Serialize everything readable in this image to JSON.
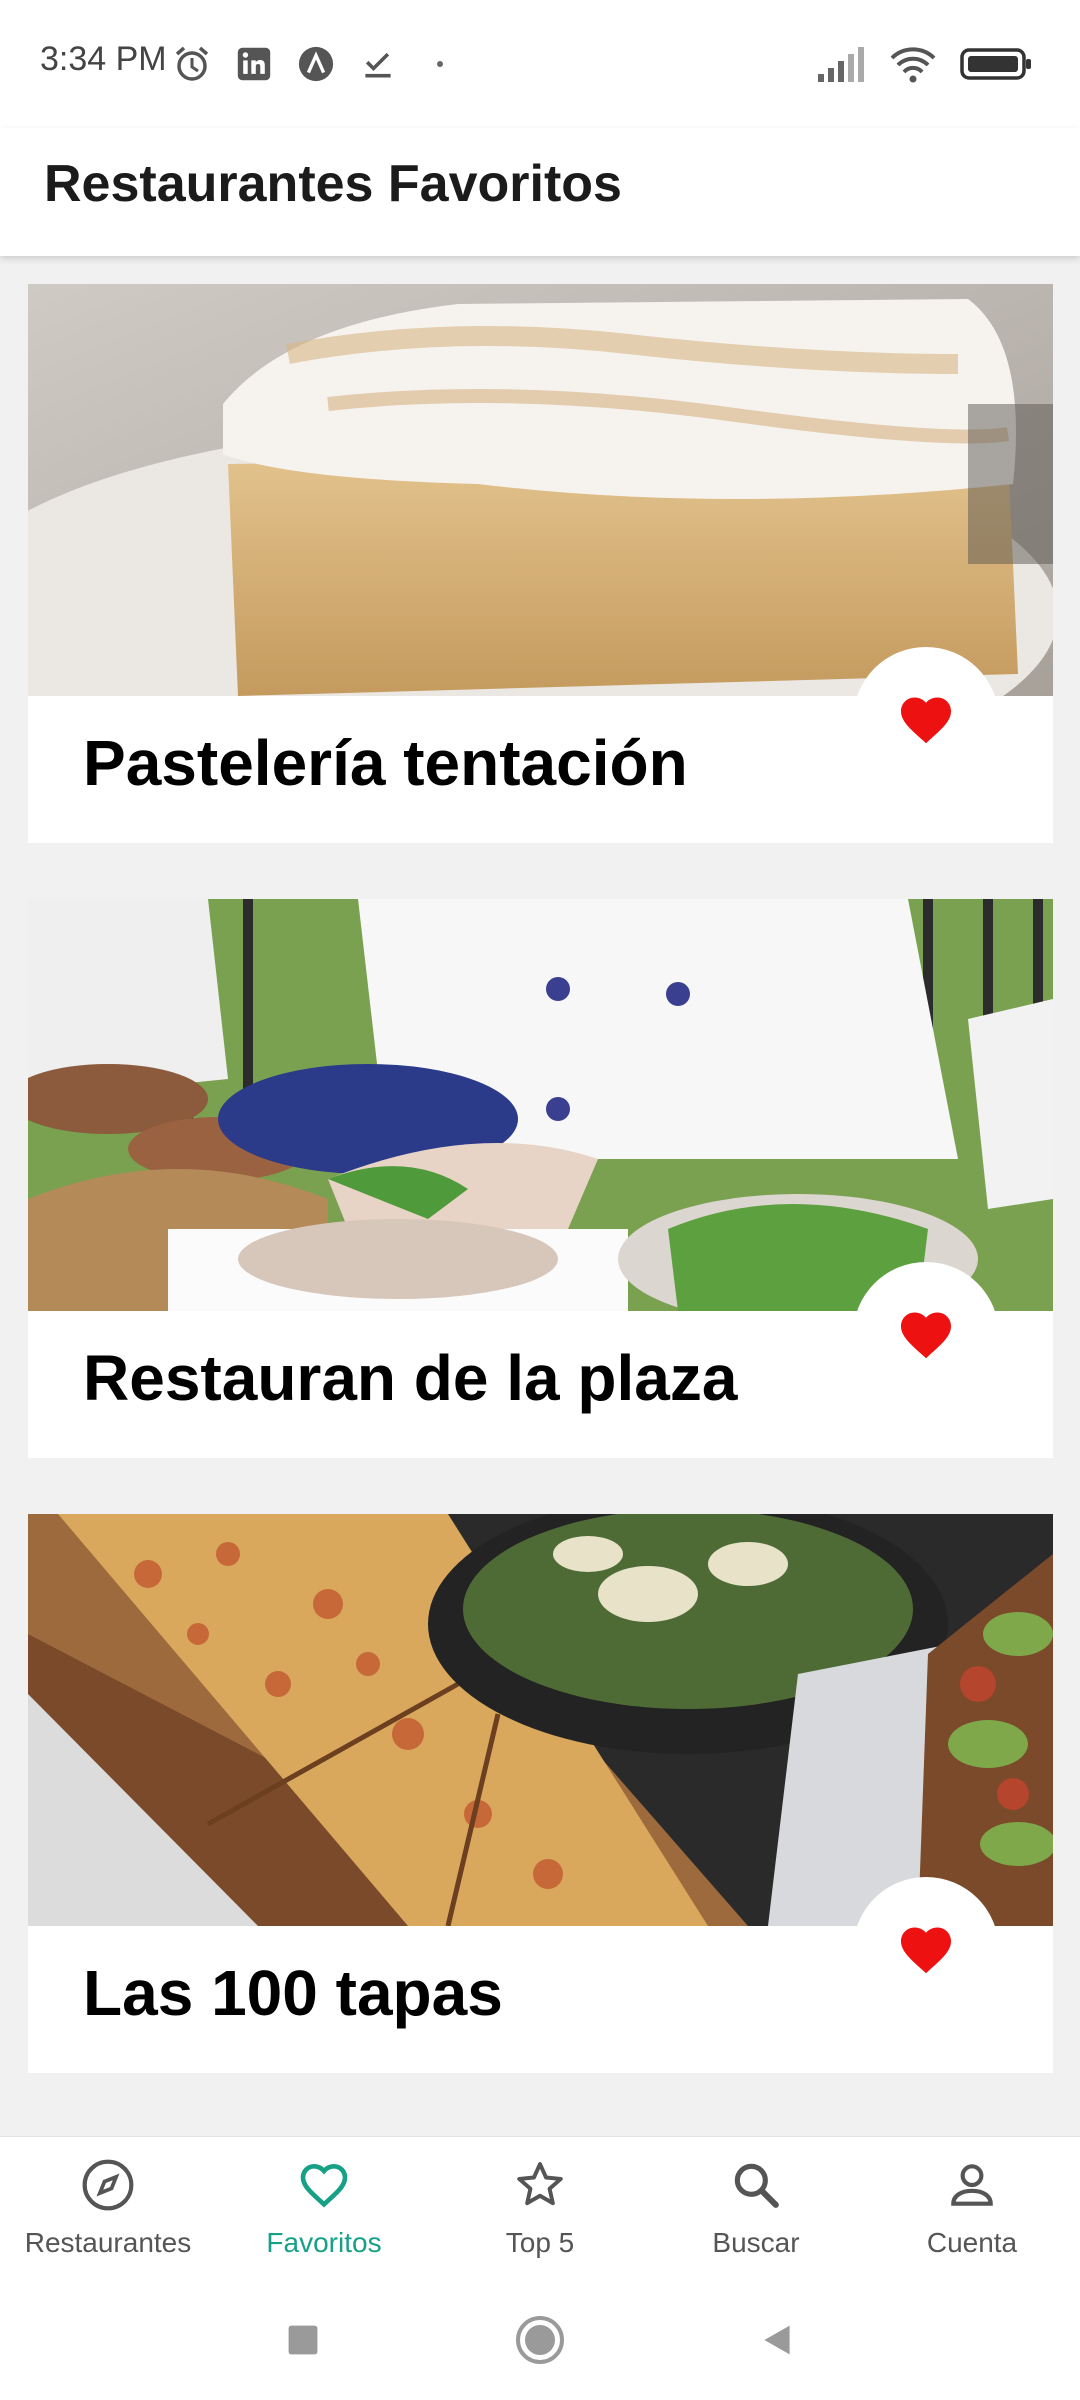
{
  "status_bar": {
    "time": "3:34 PM",
    "left_icons": [
      "alarm-icon",
      "linkedin-icon",
      "app-a-icon",
      "check-icon",
      "dot-icon"
    ],
    "right_icons": [
      "signal-icon",
      "wifi-icon",
      "battery-icon"
    ]
  },
  "app_bar": {
    "title": "Restaurantes Favoritos"
  },
  "restaurants": [
    {
      "name": "Pastelería tentación",
      "image": "cake-photo",
      "favorite": true
    },
    {
      "name": "Restauran de la plaza",
      "image": "food-table-photo",
      "favorite": true
    },
    {
      "name": "Las 100 tapas",
      "image": "pizza-salad-photo",
      "favorite": true
    }
  ],
  "bottom_nav": {
    "items": [
      {
        "label": "Restaurantes",
        "icon": "compass-icon",
        "active": false
      },
      {
        "label": "Favoritos",
        "icon": "heart-outline-icon",
        "active": true
      },
      {
        "label": "Top 5",
        "icon": "star-icon",
        "active": false
      },
      {
        "label": "Buscar",
        "icon": "search-icon",
        "active": false
      },
      {
        "label": "Cuenta",
        "icon": "person-icon",
        "active": false
      }
    ]
  },
  "system_nav": [
    "recents-button",
    "home-button",
    "back-button"
  ],
  "colors": {
    "accent": "#16a085",
    "heart": "#ee1111",
    "background": "#f1f1f1"
  }
}
